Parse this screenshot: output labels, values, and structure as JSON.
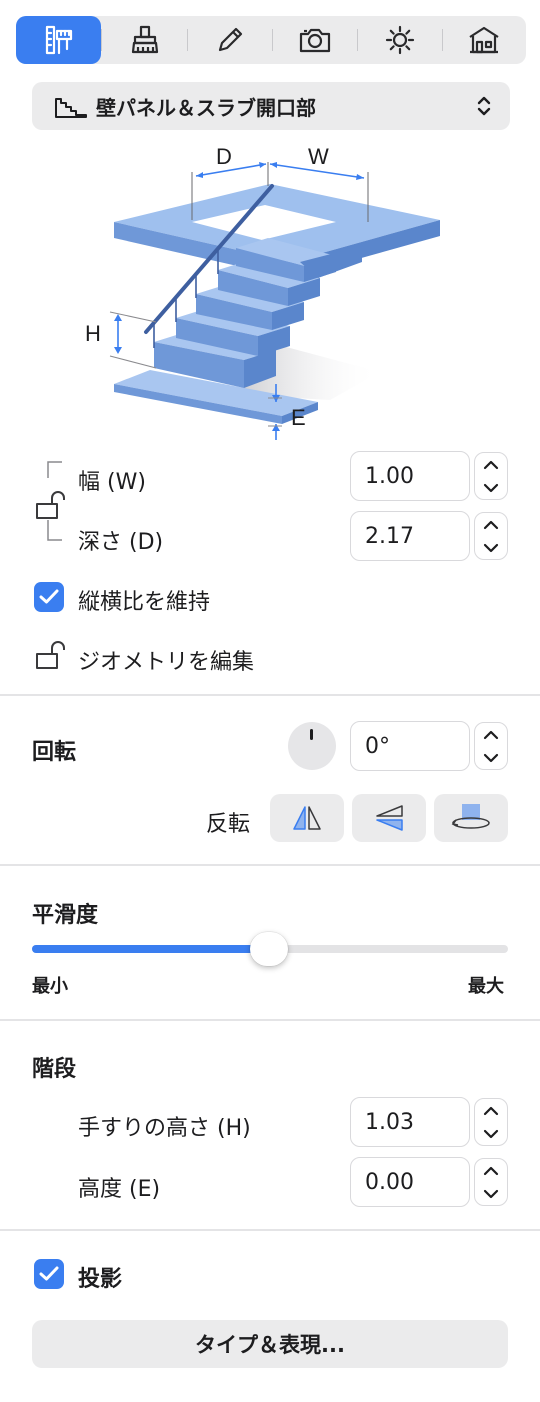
{
  "toolbar": {
    "tabs": [
      {
        "icon": "ruler-pencil-icon",
        "active": true
      },
      {
        "icon": "stamp-icon",
        "active": false
      },
      {
        "icon": "pencil-icon",
        "active": false
      },
      {
        "icon": "camera-icon",
        "active": false
      },
      {
        "icon": "sun-icon",
        "active": false
      },
      {
        "icon": "house-icon",
        "active": false
      }
    ]
  },
  "object_type": {
    "icon": "stairs-icon",
    "label": "壁パネル＆スラブ開口部"
  },
  "illustration": {
    "icon": "stair-opening-diagram",
    "labels": {
      "d": "D",
      "w": "W",
      "h": "H",
      "e": "E"
    }
  },
  "size": {
    "width_label": "幅 (W)",
    "width_value": "1.00",
    "depth_label": "深さ (D)",
    "depth_value": "2.17",
    "keep_ratio_label": "縦横比を維持",
    "keep_ratio_checked": true,
    "edit_geometry_label": "ジオメトリを編集"
  },
  "rotation": {
    "heading": "回転",
    "value": "0°",
    "flip_label": "反転"
  },
  "smoothness": {
    "heading": "平滑度",
    "min_label": "最小",
    "max_label": "最大",
    "level": 0.5
  },
  "stairs": {
    "heading": "階段",
    "handrail_label": "手すりの高さ (H)",
    "handrail_value": "1.03",
    "elevation_label": "高度 (E)",
    "elevation_value": "0.00"
  },
  "shadow": {
    "label": "投影",
    "checked": true
  },
  "type_button_label": "タイプ＆表現...",
  "colors": {
    "accent": "#3a7ef0",
    "stair_blue": "#8fb6ea"
  }
}
